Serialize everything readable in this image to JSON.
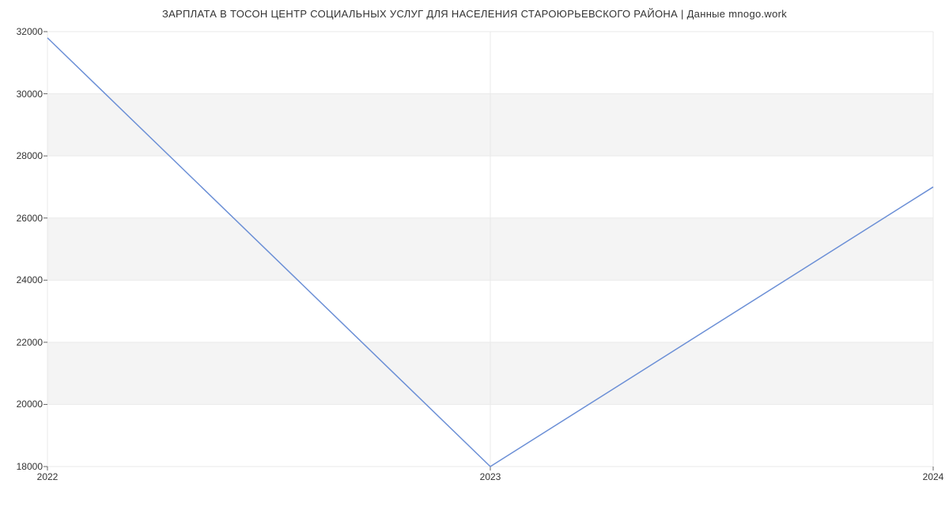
{
  "chart_data": {
    "type": "line",
    "title": "ЗАРПЛАТА В ТОСОН ЦЕНТР СОЦИАЛЬНЫХ УСЛУГ ДЛЯ НАСЕЛЕНИЯ СТАРОЮРЬЕВСКОГО РАЙОНА | Данные mnogo.work",
    "x": [
      2022,
      2023,
      2024
    ],
    "values": [
      31800,
      18000,
      27000
    ],
    "xlabel": "",
    "ylabel": "",
    "xlim": [
      2022,
      2024
    ],
    "ylim": [
      18000,
      32000
    ],
    "yticks": [
      18000,
      20000,
      22000,
      24000,
      26000,
      28000,
      30000,
      32000
    ],
    "xticks": [
      2022,
      2023,
      2024
    ],
    "line_color": "#6b8fd6",
    "band_color": "#f4f4f4",
    "grid_color": "#e9e9e9"
  }
}
